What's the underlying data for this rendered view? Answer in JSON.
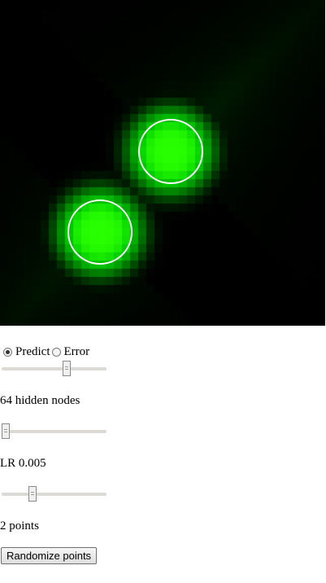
{
  "mode": {
    "options": [
      {
        "label": "Predict",
        "checked": true
      },
      {
        "label": "Error",
        "checked": false
      }
    ]
  },
  "sliders": {
    "top": {
      "fraction": 0.63
    },
    "hidden_nodes": {
      "fraction": 0.0,
      "label": "64 hidden nodes"
    },
    "learning_rate": {
      "fraction": 0.28,
      "label": "LR 0.005"
    },
    "points": {
      "label": "2 points"
    }
  },
  "buttons": {
    "randomize": "Randomize points"
  },
  "colors": {
    "prediction": "#00ff00",
    "background": "#000000",
    "circle": "#ffffff"
  }
}
